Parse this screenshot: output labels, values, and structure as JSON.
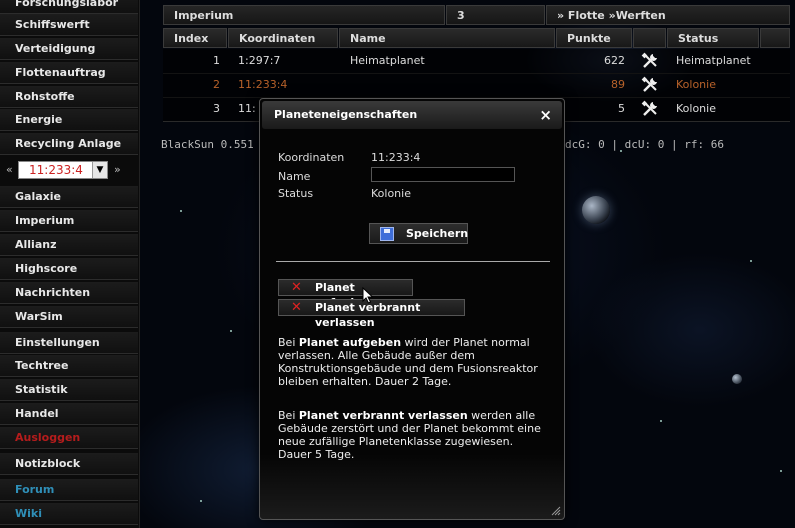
{
  "sidebar": {
    "items_top": [
      "Forschungslabor",
      "Schiffswerft",
      "Verteidigung",
      "Flottenauftrag",
      "Rohstoffe",
      "Energie",
      "Recycling Anlage"
    ],
    "planet_select": {
      "prev": "«",
      "value": "11:233:4",
      "next": "»"
    },
    "items_bottom": [
      "Galaxie",
      "Imperium",
      "Allianz",
      "Highscore",
      "Nachrichten",
      "WarSim",
      "Einstellungen",
      "Techtree",
      "Statistik",
      "Handel",
      "Ausloggen",
      "Notizblock",
      "Forum",
      "Wiki"
    ]
  },
  "topbar": {
    "section": "Imperium",
    "count": "3",
    "links": "» Flotte »Werften"
  },
  "table": {
    "headers": [
      "Index",
      "Koordinaten",
      "Name",
      "Punkte",
      "Status"
    ],
    "rows": [
      {
        "index": "1",
        "coords": "1:297:7",
        "name": "Heimatplanet",
        "points": "622",
        "status": "Heimatplanet"
      },
      {
        "index": "2",
        "coords": "11:233:4",
        "name": "",
        "points": "89",
        "status": "Kolonie"
      },
      {
        "index": "3",
        "coords": "11:",
        "name": "",
        "points": "5",
        "status": "Kolonie"
      }
    ]
  },
  "stats": {
    "left": "BlackSun 0.551",
    "right": "dcG: 0 | dcU: 0 | rf: 66"
  },
  "dialog": {
    "title": "Planeteneigenschaften",
    "close": "×",
    "coords_label": "Koordinaten",
    "coords_value": "11:233:4",
    "name_label": "Name",
    "name_value": "",
    "status_label": "Status",
    "status_value": "Kolonie",
    "save_label": "Speichern",
    "abandon_label": "Planet aufgeben",
    "burn_label": "Planet verbrannt verlassen",
    "para1_prefix": "Bei ",
    "para1_bold": "Planet aufgeben",
    "para1_text": " wird der Planet normal verlassen. Alle Gebäude außer dem Konstruktionsgebäude und dem Fusionsreaktor bleiben erhalten. Dauer 2 Tage.",
    "para2_prefix": "Bei ",
    "para2_bold": "Planet verbrannt verlassen",
    "para2_text": " werden alle Gebäude zerstört und der Planet bekommt eine neue zufällige Planetenklasse zugewiesen. Dauer 5 Tage."
  },
  "colors": {
    "colony": "#b8622a",
    "logout": "#b51c1c",
    "links": "#2f8fb8"
  }
}
